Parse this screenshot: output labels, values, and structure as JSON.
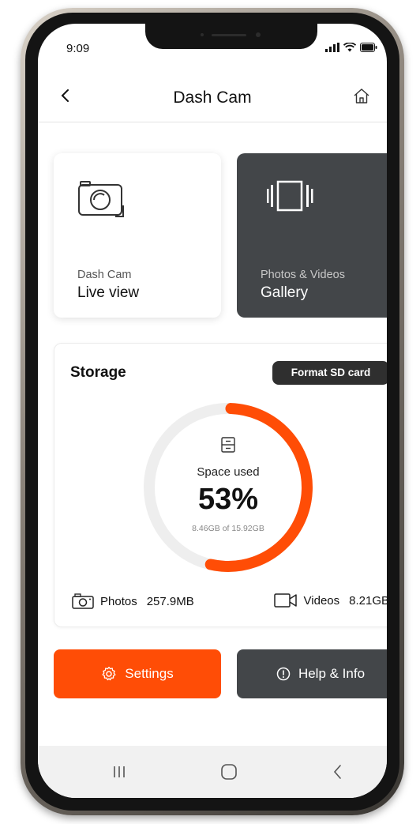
{
  "status": {
    "time": "9:09"
  },
  "header": {
    "title": "Dash Cam"
  },
  "cards": {
    "live": {
      "sublabel": "Dash Cam",
      "label": "Live view"
    },
    "gallery": {
      "sublabel": "Photos & Videos",
      "label": "Gallery"
    }
  },
  "storage": {
    "title": "Storage",
    "format_label": "Format SD card",
    "space_label": "Space used",
    "percent_text": "53%",
    "percent_value": 53,
    "detail": "8.46GB of 15.92GB",
    "photos_label": "Photos",
    "photos_value": "257.9MB",
    "videos_label": "Videos",
    "videos_value": "8.21GB"
  },
  "actions": {
    "settings_label": "Settings",
    "help_label": "Help & Info"
  },
  "colors": {
    "accent": "#ff4d06",
    "dark_card": "#434649",
    "gauge_track": "#eeeeee"
  },
  "icons": [
    "back-icon",
    "home-icon",
    "camera-icon",
    "gallery-icon",
    "drawer-icon",
    "photo-icon",
    "video-icon",
    "gear-icon",
    "info-icon",
    "recents-icon",
    "home-nav-icon",
    "back-nav-icon"
  ]
}
